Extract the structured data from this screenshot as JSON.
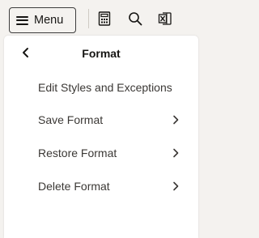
{
  "toolbar": {
    "menu_label": "Menu",
    "icons": [
      "calculator-icon",
      "search-icon",
      "excel-export-icon"
    ]
  },
  "panel": {
    "title": "Format",
    "items": [
      {
        "label": "Edit Styles and Exceptions",
        "has_submenu": false
      },
      {
        "label": "Save Format",
        "has_submenu": true
      },
      {
        "label": "Restore Format",
        "has_submenu": true
      },
      {
        "label": "Delete Format",
        "has_submenu": true
      }
    ]
  },
  "colors": {
    "toolbar_bg": "#f4f2ef",
    "panel_bg": "#ffffff",
    "text": "#3b3835"
  }
}
